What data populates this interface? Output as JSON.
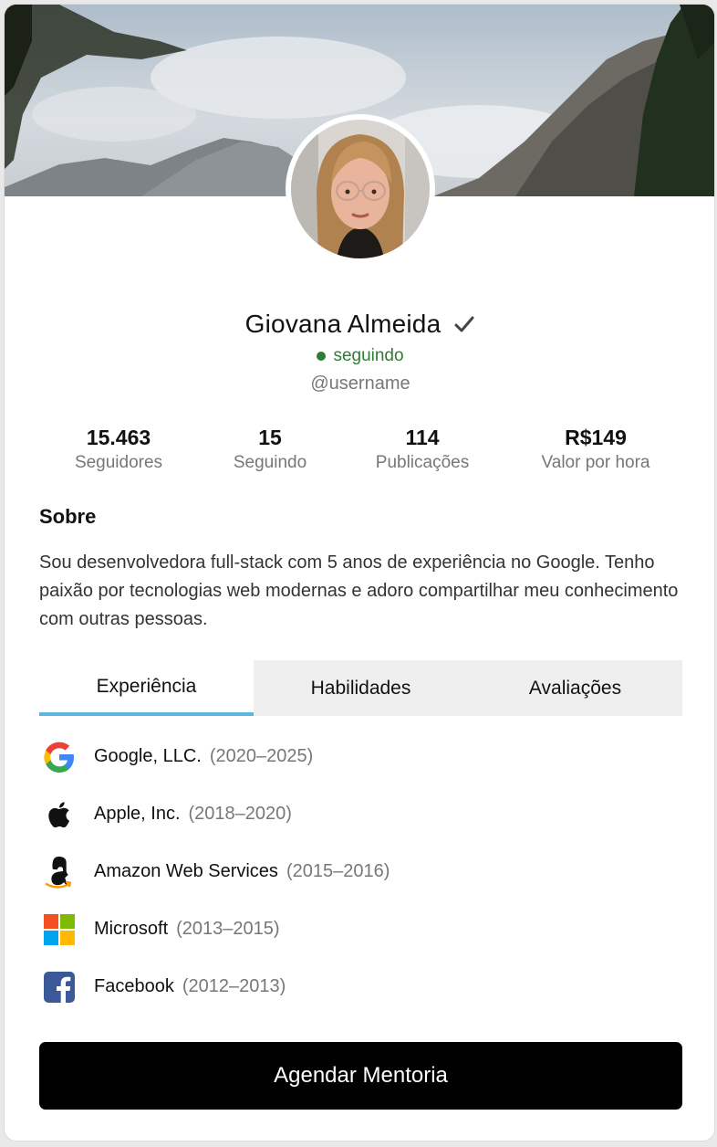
{
  "profile": {
    "name": "Giovana Almeida",
    "status": "seguindo",
    "username": "@username",
    "verified_icon": "checkmark-icon",
    "status_color": "#2e7d32"
  },
  "stats": [
    {
      "value": "15.463",
      "label": "Seguidores"
    },
    {
      "value": "15",
      "label": "Seguindo"
    },
    {
      "value": "114",
      "label": "Publicações"
    },
    {
      "value": "R$149",
      "label": "Valor por hora"
    }
  ],
  "about": {
    "title": "Sobre",
    "text": "Sou desenvolvedora full-stack com 5 anos de experiência no Google. Tenho paixão por tecnologias web modernas e adoro compartilhar meu conhecimento com outras pessoas."
  },
  "tabs": [
    {
      "label": "Experiência",
      "active": true
    },
    {
      "label": "Habilidades",
      "active": false
    },
    {
      "label": "Avaliações",
      "active": false
    }
  ],
  "experience": [
    {
      "company": "Google, LLC.",
      "period": "(2020–2025)",
      "icon": "google-logo-icon"
    },
    {
      "company": "Apple, Inc.",
      "period": "(2018–2020)",
      "icon": "apple-logo-icon"
    },
    {
      "company": "Amazon Web Services",
      "period": "(2015–2016)",
      "icon": "amazon-logo-icon"
    },
    {
      "company": "Microsoft",
      "period": "(2013–2015)",
      "icon": "microsoft-logo-icon"
    },
    {
      "company": "Facebook",
      "period": "(2012–2013)",
      "icon": "facebook-logo-icon"
    }
  ],
  "cta": {
    "label": "Agendar Mentoria"
  },
  "colors": {
    "accent": "#5bb6e0",
    "cta_bg": "#000000"
  }
}
